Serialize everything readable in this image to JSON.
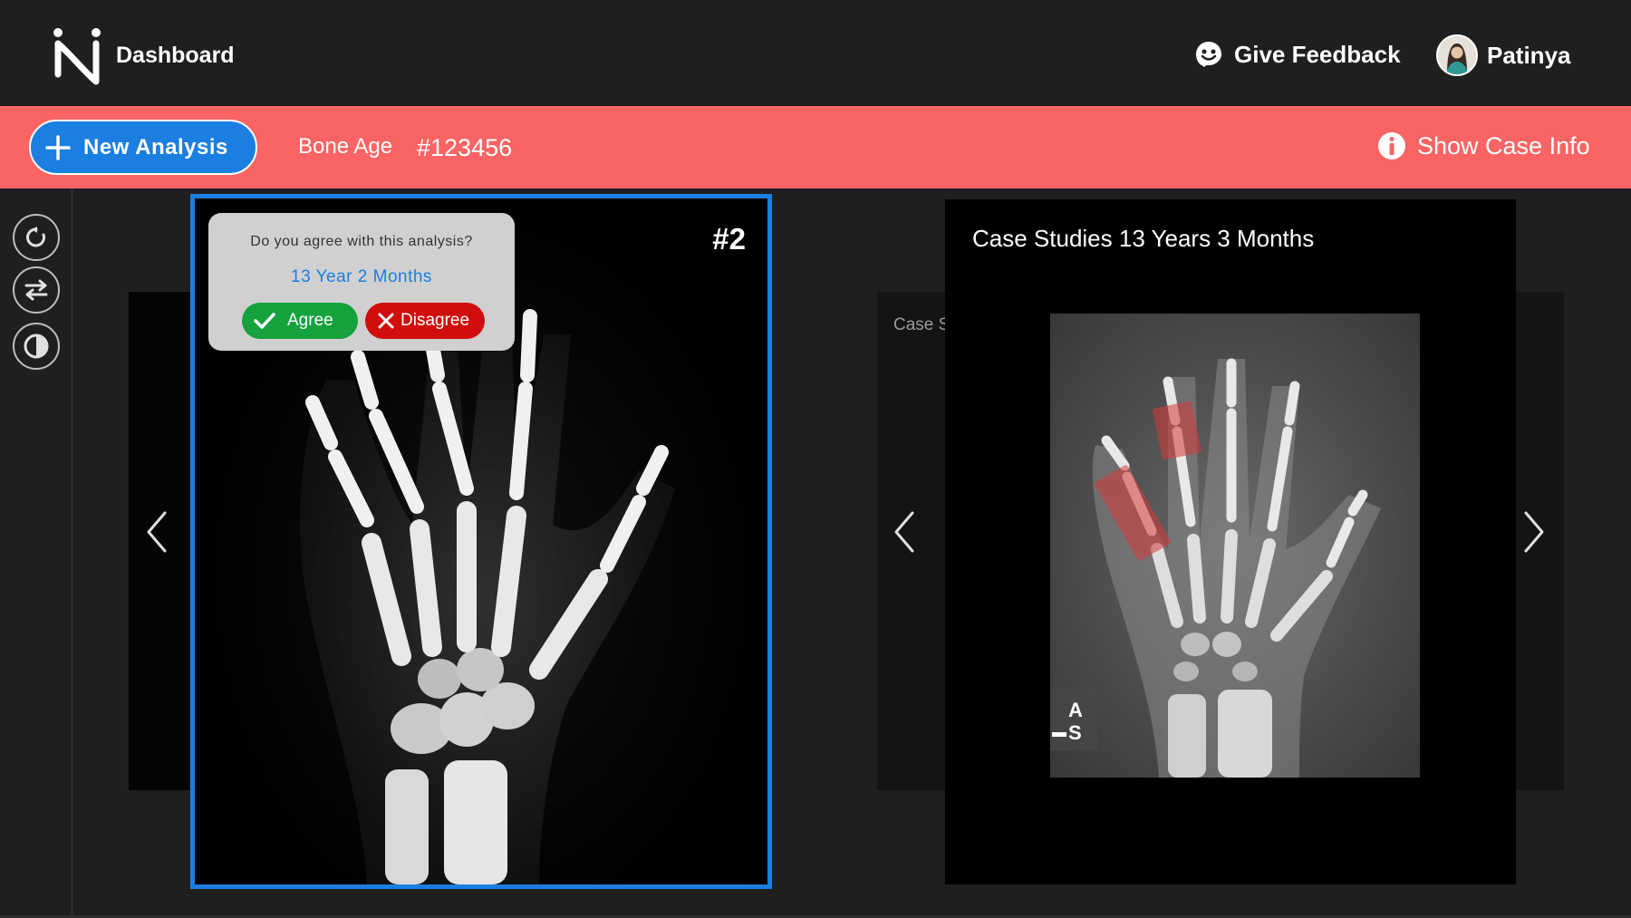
{
  "header": {
    "title": "Dashboard",
    "feedback_label": "Give Feedback",
    "user_name": "Patinya"
  },
  "case_bar": {
    "new_analysis_label": "New Analysis",
    "case_type": "Bone Age",
    "case_id": "#123456",
    "show_case_info_label": "Show Case Info",
    "color": "#fb6464"
  },
  "toolbar": {
    "tools": [
      "reset-icon",
      "swap-icon",
      "contrast-icon"
    ]
  },
  "viewer": {
    "image_number": "#2",
    "prompt": {
      "question": "Do you agree with this analysis?",
      "analysis_value": "13 Year 2 Months",
      "agree_label": "Agree",
      "disagree_label": "Disagree"
    },
    "accent_color": "#1a7fe0"
  },
  "case_study": {
    "title": "Case Studies 13 Years 3 Months",
    "peek_text": "Case S",
    "marker_top": "A",
    "marker_bottom": "S"
  }
}
